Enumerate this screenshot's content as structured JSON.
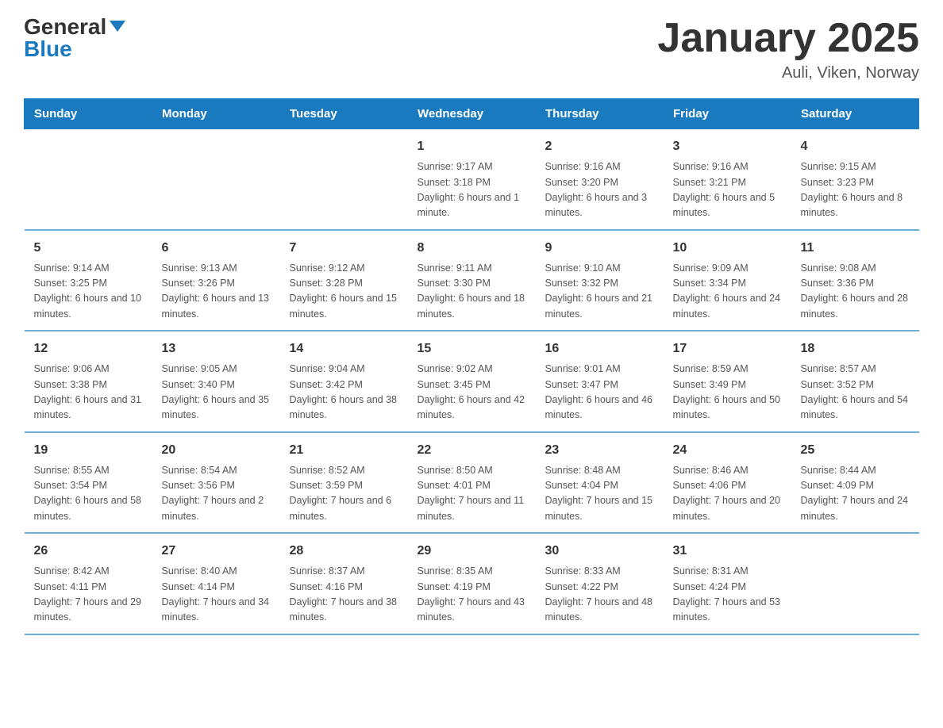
{
  "header": {
    "logo_general": "General",
    "logo_blue": "Blue",
    "month_year": "January 2025",
    "location": "Auli, Viken, Norway"
  },
  "days_of_week": [
    "Sunday",
    "Monday",
    "Tuesday",
    "Wednesday",
    "Thursday",
    "Friday",
    "Saturday"
  ],
  "weeks": [
    [
      {
        "day": "",
        "info": ""
      },
      {
        "day": "",
        "info": ""
      },
      {
        "day": "",
        "info": ""
      },
      {
        "day": "1",
        "info": "Sunrise: 9:17 AM\nSunset: 3:18 PM\nDaylight: 6 hours and 1 minute."
      },
      {
        "day": "2",
        "info": "Sunrise: 9:16 AM\nSunset: 3:20 PM\nDaylight: 6 hours and 3 minutes."
      },
      {
        "day": "3",
        "info": "Sunrise: 9:16 AM\nSunset: 3:21 PM\nDaylight: 6 hours and 5 minutes."
      },
      {
        "day": "4",
        "info": "Sunrise: 9:15 AM\nSunset: 3:23 PM\nDaylight: 6 hours and 8 minutes."
      }
    ],
    [
      {
        "day": "5",
        "info": "Sunrise: 9:14 AM\nSunset: 3:25 PM\nDaylight: 6 hours and 10 minutes."
      },
      {
        "day": "6",
        "info": "Sunrise: 9:13 AM\nSunset: 3:26 PM\nDaylight: 6 hours and 13 minutes."
      },
      {
        "day": "7",
        "info": "Sunrise: 9:12 AM\nSunset: 3:28 PM\nDaylight: 6 hours and 15 minutes."
      },
      {
        "day": "8",
        "info": "Sunrise: 9:11 AM\nSunset: 3:30 PM\nDaylight: 6 hours and 18 minutes."
      },
      {
        "day": "9",
        "info": "Sunrise: 9:10 AM\nSunset: 3:32 PM\nDaylight: 6 hours and 21 minutes."
      },
      {
        "day": "10",
        "info": "Sunrise: 9:09 AM\nSunset: 3:34 PM\nDaylight: 6 hours and 24 minutes."
      },
      {
        "day": "11",
        "info": "Sunrise: 9:08 AM\nSunset: 3:36 PM\nDaylight: 6 hours and 28 minutes."
      }
    ],
    [
      {
        "day": "12",
        "info": "Sunrise: 9:06 AM\nSunset: 3:38 PM\nDaylight: 6 hours and 31 minutes."
      },
      {
        "day": "13",
        "info": "Sunrise: 9:05 AM\nSunset: 3:40 PM\nDaylight: 6 hours and 35 minutes."
      },
      {
        "day": "14",
        "info": "Sunrise: 9:04 AM\nSunset: 3:42 PM\nDaylight: 6 hours and 38 minutes."
      },
      {
        "day": "15",
        "info": "Sunrise: 9:02 AM\nSunset: 3:45 PM\nDaylight: 6 hours and 42 minutes."
      },
      {
        "day": "16",
        "info": "Sunrise: 9:01 AM\nSunset: 3:47 PM\nDaylight: 6 hours and 46 minutes."
      },
      {
        "day": "17",
        "info": "Sunrise: 8:59 AM\nSunset: 3:49 PM\nDaylight: 6 hours and 50 minutes."
      },
      {
        "day": "18",
        "info": "Sunrise: 8:57 AM\nSunset: 3:52 PM\nDaylight: 6 hours and 54 minutes."
      }
    ],
    [
      {
        "day": "19",
        "info": "Sunrise: 8:55 AM\nSunset: 3:54 PM\nDaylight: 6 hours and 58 minutes."
      },
      {
        "day": "20",
        "info": "Sunrise: 8:54 AM\nSunset: 3:56 PM\nDaylight: 7 hours and 2 minutes."
      },
      {
        "day": "21",
        "info": "Sunrise: 8:52 AM\nSunset: 3:59 PM\nDaylight: 7 hours and 6 minutes."
      },
      {
        "day": "22",
        "info": "Sunrise: 8:50 AM\nSunset: 4:01 PM\nDaylight: 7 hours and 11 minutes."
      },
      {
        "day": "23",
        "info": "Sunrise: 8:48 AM\nSunset: 4:04 PM\nDaylight: 7 hours and 15 minutes."
      },
      {
        "day": "24",
        "info": "Sunrise: 8:46 AM\nSunset: 4:06 PM\nDaylight: 7 hours and 20 minutes."
      },
      {
        "day": "25",
        "info": "Sunrise: 8:44 AM\nSunset: 4:09 PM\nDaylight: 7 hours and 24 minutes."
      }
    ],
    [
      {
        "day": "26",
        "info": "Sunrise: 8:42 AM\nSunset: 4:11 PM\nDaylight: 7 hours and 29 minutes."
      },
      {
        "day": "27",
        "info": "Sunrise: 8:40 AM\nSunset: 4:14 PM\nDaylight: 7 hours and 34 minutes."
      },
      {
        "day": "28",
        "info": "Sunrise: 8:37 AM\nSunset: 4:16 PM\nDaylight: 7 hours and 38 minutes."
      },
      {
        "day": "29",
        "info": "Sunrise: 8:35 AM\nSunset: 4:19 PM\nDaylight: 7 hours and 43 minutes."
      },
      {
        "day": "30",
        "info": "Sunrise: 8:33 AM\nSunset: 4:22 PM\nDaylight: 7 hours and 48 minutes."
      },
      {
        "day": "31",
        "info": "Sunrise: 8:31 AM\nSunset: 4:24 PM\nDaylight: 7 hours and 53 minutes."
      },
      {
        "day": "",
        "info": ""
      }
    ]
  ]
}
